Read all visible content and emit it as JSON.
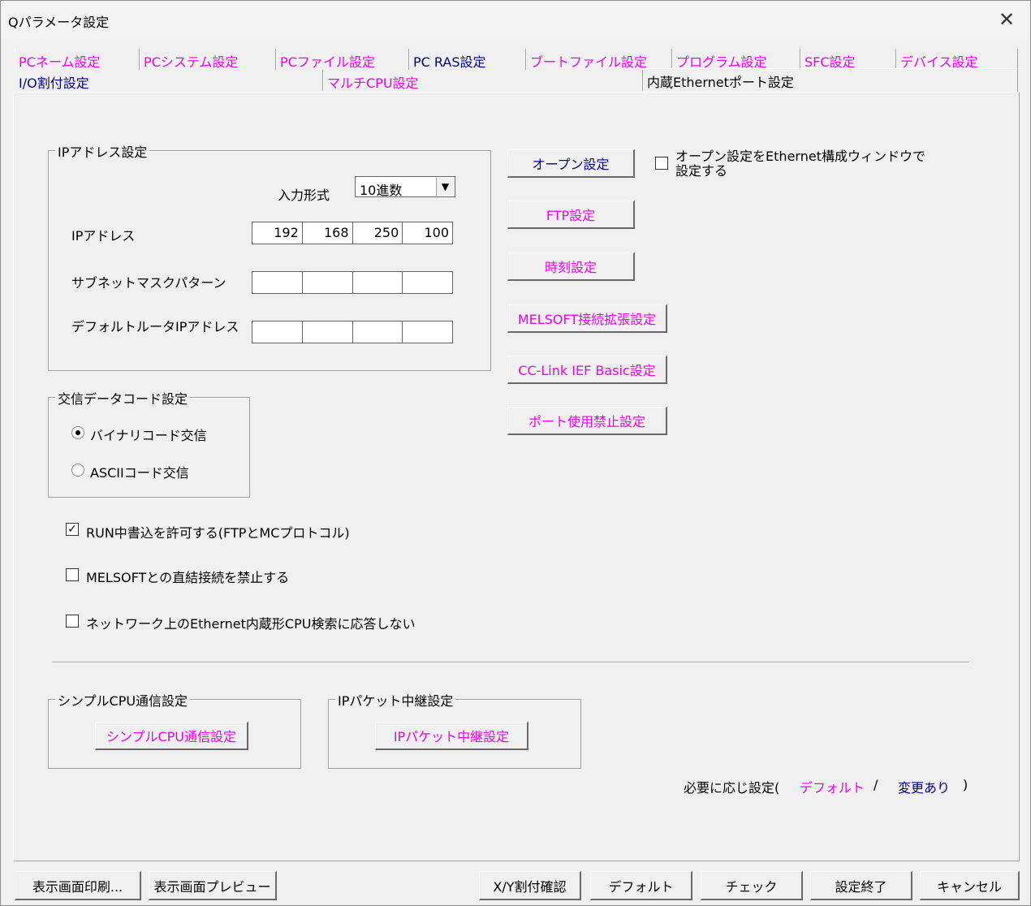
{
  "window": {
    "title": "Qパラメータ設定",
    "close_glyph": "✕"
  },
  "tabs": {
    "row1": [
      "PCネーム設定",
      "PCシステム設定",
      "PCファイル設定",
      "PC RAS設定",
      "ブートファイル設定",
      "プログラム設定",
      "SFC設定",
      "デバイス設定"
    ],
    "row2": [
      "I/O割付設定",
      "マルチCPU設定",
      "内蔵Ethernetポート設定"
    ]
  },
  "ip_group": {
    "title": "IPアドレス設定",
    "input_format_label": "入力形式",
    "input_format_value": "10進数",
    "ip_label": "IPアドレス",
    "ip": [
      "192",
      "168",
      "250",
      "100"
    ],
    "subnet_label": "サブネットマスクパターン",
    "subnet": [
      "",
      "",
      "",
      ""
    ],
    "gateway_label": "デフォルトルータIPアドレス",
    "gateway": [
      "",
      "",
      "",
      ""
    ]
  },
  "right_buttons": {
    "open": "オープン設定",
    "ftp": "FTP設定",
    "time": "時刻設定",
    "melsoft": "MELSOFT接続拡張設定",
    "cclink": "CC-Link IEF Basic設定",
    "port": "ポート使用禁止設定"
  },
  "open_window_check": {
    "label_line1": "オープン設定をEthernet構成ウィンドウで",
    "label_line2": "設定する",
    "checked": false
  },
  "code_group": {
    "title": "交信データコード設定",
    "binary": "バイナリコード交信",
    "ascii": "ASCIIコード交信",
    "selected": "binary"
  },
  "checks": {
    "run_write": {
      "label": "RUN中書込を許可する(FTPとMCプロトコル)",
      "checked": true,
      "mark": "✓"
    },
    "melsoft_direct": {
      "label": "MELSOFTとの直結接続を禁止する",
      "checked": false
    },
    "no_response": {
      "label": "ネットワーク上のEthernet内蔵形CPU検索に応答しない",
      "checked": false
    }
  },
  "simple_group": {
    "title": "シンプルCPU通信設定",
    "button": "シンプルCPU通信設定"
  },
  "relay_group": {
    "title": "IPパケット中継設定",
    "button": "IPパケット中継設定"
  },
  "legend": {
    "prefix": "必要に応じ設定(",
    "default": "デフォルト",
    "slash": "/",
    "changed": "変更あり",
    "suffix": ")"
  },
  "bottom": {
    "print": "表示画面印刷...",
    "preview": "表示画面プレビュー",
    "xy": "X/Y割付確認",
    "default": "デフォルト",
    "check": "チェック",
    "finish": "設定終了",
    "cancel": "キャンセル"
  },
  "colors": {
    "pink": "#ee00ee",
    "navy": "#000080"
  }
}
